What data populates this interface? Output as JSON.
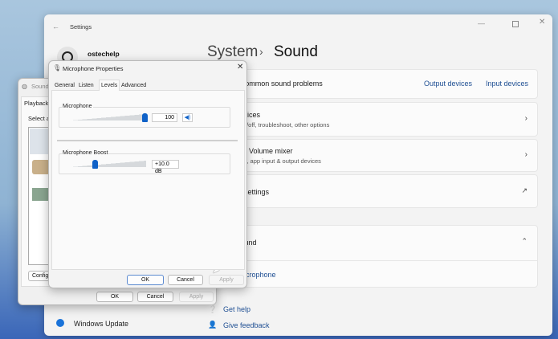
{
  "settings": {
    "window_title": "Settings",
    "user_name": "ostechelp",
    "breadcrumb_parent": "System",
    "breadcrumb_sep": "›",
    "breadcrumb_current": "Sound",
    "troubleshoot": "Troubleshoot common sound problems",
    "output_devices": "Output devices",
    "input_devices": "Input devices",
    "all_devices_title": "All sound devices",
    "all_devices_sub": "Turn devices on/off, troubleshoot, other options",
    "mixer_title": "Volume mixer",
    "mixer_sub": "App volume mix, app input & output devices",
    "more_settings": "More sound settings",
    "help_title": "Help with Sound",
    "help_link": "Setting up a microphone",
    "get_help": "Get help",
    "give_feedback": "Give feedback",
    "sidebar_windows_update": "Windows Update"
  },
  "sound_dialog": {
    "title": "Sound",
    "tab_playback": "Playback",
    "select_label": "Select a",
    "configure": "Configure",
    "ok": "OK",
    "cancel": "Cancel",
    "apply": "Apply"
  },
  "mic_dialog": {
    "title": "Microphone Properties",
    "tabs": [
      "General",
      "Listen",
      "Levels",
      "Advanced"
    ],
    "selected_tab": "Levels",
    "mic_label": "Microphone",
    "mic_value": "100",
    "mic_level_percent": 100,
    "boost_label": "Microphone Boost",
    "boost_value": "+10.0 dB",
    "boost_level_fraction": 0.33,
    "ok": "OK",
    "cancel": "Cancel",
    "apply": "Apply"
  },
  "colors": {
    "accent": "#0f62c8",
    "link": "#1f4f93"
  }
}
